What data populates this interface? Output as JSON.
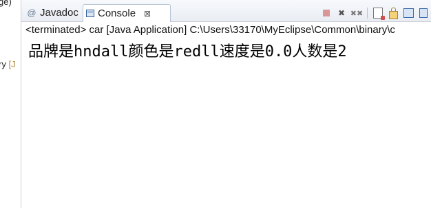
{
  "left_pane": {
    "line1": "ge)",
    "line2_main": "ry",
    "line2_dim": "[J"
  },
  "tabs": [
    {
      "label": "Javadoc",
      "icon": "at-icon"
    },
    {
      "label": "Console",
      "icon": "console-icon",
      "close": "⊠"
    }
  ],
  "console": {
    "status": "<terminated> car [Java Application] C:\\Users\\33170\\MyEclipse\\Common\\binary\\c",
    "output": "品牌是hndall颜色是redll速度是0.0人数是2"
  },
  "toolbar": {
    "icons": [
      "terminate-icon",
      "remove-launch-icon",
      "remove-all-terminated-icon",
      "clear-console-icon",
      "scroll-lock-icon",
      "pin-console-icon",
      "display-selected-console-icon"
    ]
  }
}
